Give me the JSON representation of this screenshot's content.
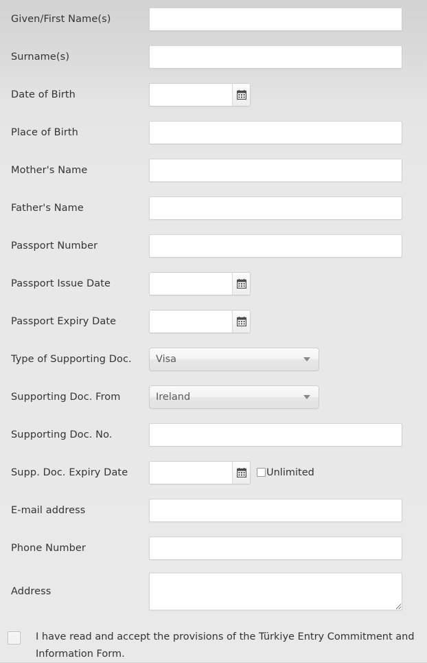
{
  "form": {
    "fields": [
      {
        "label": "Given/First Name(s)",
        "type": "text",
        "value": "",
        "name": "given-name"
      },
      {
        "label": "Surname(s)",
        "type": "text",
        "value": "",
        "name": "surname"
      },
      {
        "label": "Date of Birth",
        "type": "date",
        "value": "",
        "name": "date-of-birth"
      },
      {
        "label": "Place of Birth",
        "type": "text",
        "value": "",
        "name": "place-of-birth"
      },
      {
        "label": "Mother's Name",
        "type": "text",
        "value": "",
        "name": "mothers-name"
      },
      {
        "label": "Father's Name",
        "type": "text",
        "value": "",
        "name": "fathers-name"
      },
      {
        "label": "Passport Number",
        "type": "text",
        "value": "",
        "name": "passport-number"
      },
      {
        "label": "Passport Issue Date",
        "type": "date",
        "value": "",
        "name": "passport-issue-date"
      },
      {
        "label": "Passport Expiry Date",
        "type": "date",
        "value": "",
        "name": "passport-expiry-date"
      },
      {
        "label": "Type of Supporting Doc.",
        "type": "select",
        "value": "Visa",
        "name": "supporting-doc-type"
      },
      {
        "label": "Supporting Doc. From",
        "type": "select",
        "value": "Ireland",
        "name": "supporting-doc-from"
      },
      {
        "label": "Supporting Doc. No.",
        "type": "text",
        "value": "",
        "name": "supporting-doc-no"
      },
      {
        "label": "Supp. Doc. Expiry Date",
        "type": "date-unlimited",
        "value": "",
        "name": "supporting-doc-expiry-date"
      },
      {
        "label": "E-mail address",
        "type": "text",
        "value": "",
        "name": "email-address"
      },
      {
        "label": "Phone Number",
        "type": "text",
        "value": "",
        "name": "phone-number"
      },
      {
        "label": "Address",
        "type": "textarea",
        "value": "",
        "name": "address"
      }
    ],
    "labels": {
      "given_name": "Given/First Name(s)",
      "surname": "Surname(s)",
      "date_of_birth": "Date of Birth",
      "place_of_birth": "Place of Birth",
      "mothers_name": "Mother's Name",
      "fathers_name": "Father's Name",
      "passport_number": "Passport Number",
      "passport_issue_date": "Passport Issue Date",
      "passport_expiry_date": "Passport Expiry Date",
      "supporting_doc_type": "Type of Supporting Doc.",
      "supporting_doc_from": "Supporting Doc. From",
      "supporting_doc_no": "Supporting Doc. No.",
      "supp_doc_expiry_date": "Supp. Doc. Expiry Date",
      "email_address": "E-mail address",
      "phone_number": "Phone Number",
      "address": "Address"
    },
    "values": {
      "supporting_doc_type": "Visa",
      "supporting_doc_from": "Ireland",
      "unlimited_label": "Unlimited"
    },
    "icons": {
      "calendar": "calendar-icon",
      "dropdown_arrow": "chevron-down-icon"
    }
  },
  "consent": {
    "text": "I have read and accept the provisions of the Türkiye Entry Commitment and Information Form.",
    "checked": false
  },
  "colors": {
    "page_background_top": "#d2d2d2",
    "page_background_bottom": "#e9e9e9",
    "label_text": "#333333",
    "input_background": "#ffffff",
    "input_border": "#cfcfcf",
    "select_text": "#5a5a5a"
  }
}
